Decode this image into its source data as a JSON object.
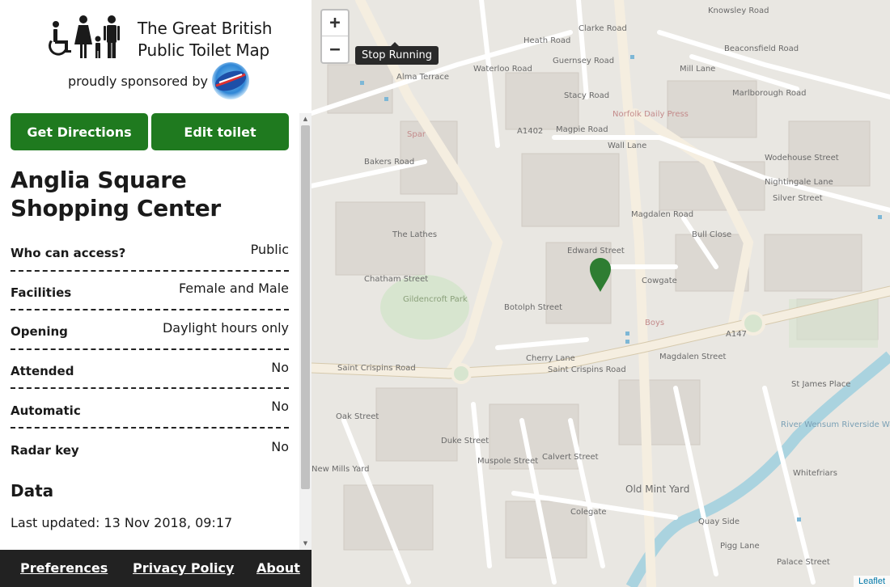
{
  "header": {
    "title_line1": "The Great British",
    "title_line2": "Public Toilet Map",
    "sponsor_text": "proudly sponsored by",
    "sponsor_logo_label": "Domestos"
  },
  "actions": {
    "directions_label": "Get Directions",
    "edit_label": "Edit toilet"
  },
  "toilet": {
    "name": "Anglia Square Shopping Center",
    "properties": [
      {
        "key": "Who can access?",
        "value": "Public"
      },
      {
        "key": "Facilities",
        "value": "Female and Male"
      },
      {
        "key": "Opening",
        "value": "Daylight hours only"
      },
      {
        "key": "Attended",
        "value": "No"
      },
      {
        "key": "Automatic",
        "value": "No"
      },
      {
        "key": "Radar key",
        "value": "No"
      }
    ],
    "data_heading": "Data",
    "last_updated": "Last updated: 13 Nov 2018, 09:17"
  },
  "footer": {
    "preferences": "Preferences",
    "privacy": "Privacy Policy",
    "about": "About"
  },
  "map": {
    "zoom_in": "+",
    "zoom_out": "−",
    "stop_running": "Stop Running",
    "attribution": "Leaflet",
    "marker_color": "#2e7d32",
    "street_labels": {
      "knowsley": "Knowsley Road",
      "clarke": "Clarke Road",
      "beaconsfield": "Beaconsfield Road",
      "guernsey": "Guernsey Road",
      "mill": "Mill Lane",
      "stacy": "Stacy Road",
      "marlborough": "Marlborough Road",
      "norfolk_daily": "Norfolk Daily Press",
      "magpie": "Magpie Road",
      "wall": "Wall Lane",
      "wodehouse": "Wodehouse Street",
      "nightingale": "Nightingale Lane",
      "silver": "Silver Street",
      "bakers": "Bakers Road",
      "lathes": "The Lathes",
      "edward": "Edward Street",
      "cowgate": "Cowgate",
      "gildencroft": "Gildencroft Park",
      "botolph": "Botolph Street",
      "cherry": "Cherry Lane",
      "saint_crispins_1": "Saint Crispins Road",
      "saint_crispins_2": "Saint Crispins Road",
      "magdalen": "Magdalen Street",
      "magdalen_street": "Magdalen Street",
      "a147": "A147",
      "a1402": "A1402",
      "st_james": "St James Place",
      "oak": "Oak Street",
      "duke": "Duke Street",
      "muspole": "Muspole Street",
      "calvert": "Calvert Street",
      "old_mint": "Old Mint Yard",
      "colegate": "Colegate",
      "new_mills": "New Mills Yard",
      "quay": "Quay Side",
      "pigg": "Pigg Lane",
      "palace": "Palace Street",
      "whitefriars": "Whitefriars",
      "river": "River Wensum Riverside Walk",
      "chatham": "Chatham Street",
      "heath": "Heath Road",
      "waterloo": "Waterloo Road",
      "alma": "Alma Terrace",
      "bull": "Bull Close",
      "boys": "Boys",
      "magdalen_road": "Magdalen Road",
      "spar": "Spar"
    }
  }
}
